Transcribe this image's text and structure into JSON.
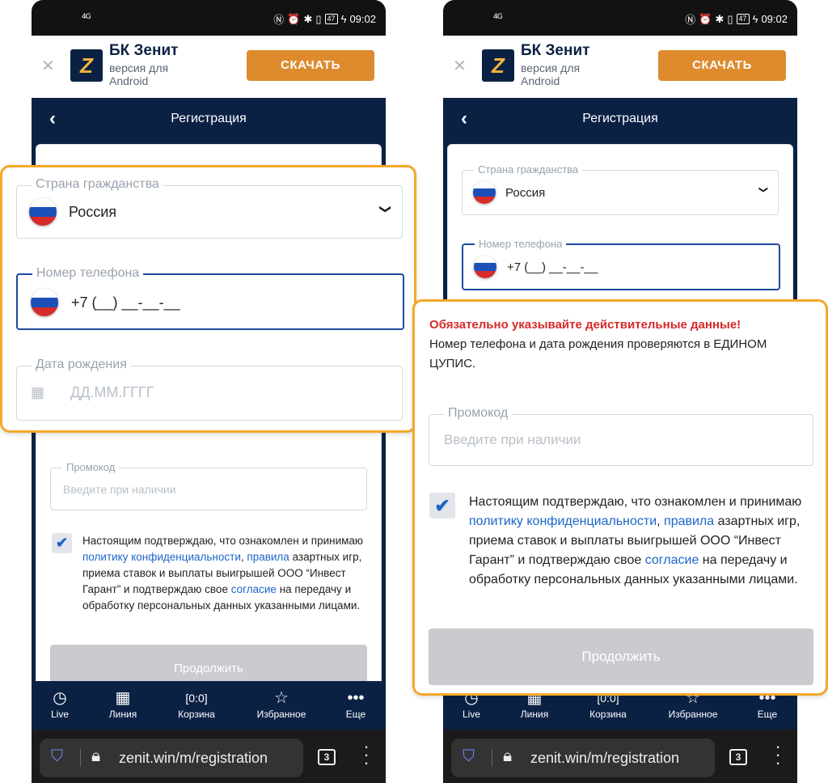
{
  "status": {
    "network": "4G",
    "time": "09:02",
    "battery": "47"
  },
  "banner": {
    "app_name": "БК Зенит",
    "subtitle": "версия для Android",
    "logo_letter": "Z",
    "download_label": "СКАЧАТЬ"
  },
  "nav": {
    "title": "Регистрация"
  },
  "form": {
    "country_label": "Страна гражданства",
    "country_value": "Россия",
    "phone_label": "Номер телефона",
    "phone_value": "+7 (__) __-__-__",
    "dob_label": "Дата рождения",
    "dob_placeholder": "ДД.ММ.ГГГГ",
    "promo_label": "Промокод",
    "promo_placeholder": "Введите при наличии",
    "consent_text_1": "Настоящим подтверждаю, что ознакомлен и принимаю ",
    "privacy_link": "политику конфиденциальности",
    "comma": ", ",
    "rules_link": "правила",
    "consent_text_2": " азартных игр, приема ставок и выплаты выигрышей ООО “Инвест Гарант” и подтверждаю свое ",
    "consent_link": "согласие",
    "consent_text_3": " на передачу и обработку персональных данных указанными лицами.",
    "continue_label": "Продолжить"
  },
  "warning": {
    "title": "Обязательно указывайте действительные данные!",
    "body": "Номер телефона и дата рождения проверяются в ЕДИНОМ ЦУПИС."
  },
  "tabs": [
    {
      "label": "Live",
      "icon": "clock-icon"
    },
    {
      "label": "Линия",
      "icon": "calendar-icon"
    },
    {
      "label": "Корзина",
      "icon": "coupon-icon"
    },
    {
      "label": "Избранное",
      "icon": "star-icon"
    },
    {
      "label": "Еще",
      "icon": "more-icon"
    }
  ],
  "browser": {
    "url": "zenit.win/m/registration",
    "tab_count": "3"
  },
  "colors": {
    "navy": "#0b2144",
    "orange": "#de8b2e",
    "highlight": "#f4a92a",
    "link": "#1c65c8",
    "warning": "#d72a2a"
  }
}
